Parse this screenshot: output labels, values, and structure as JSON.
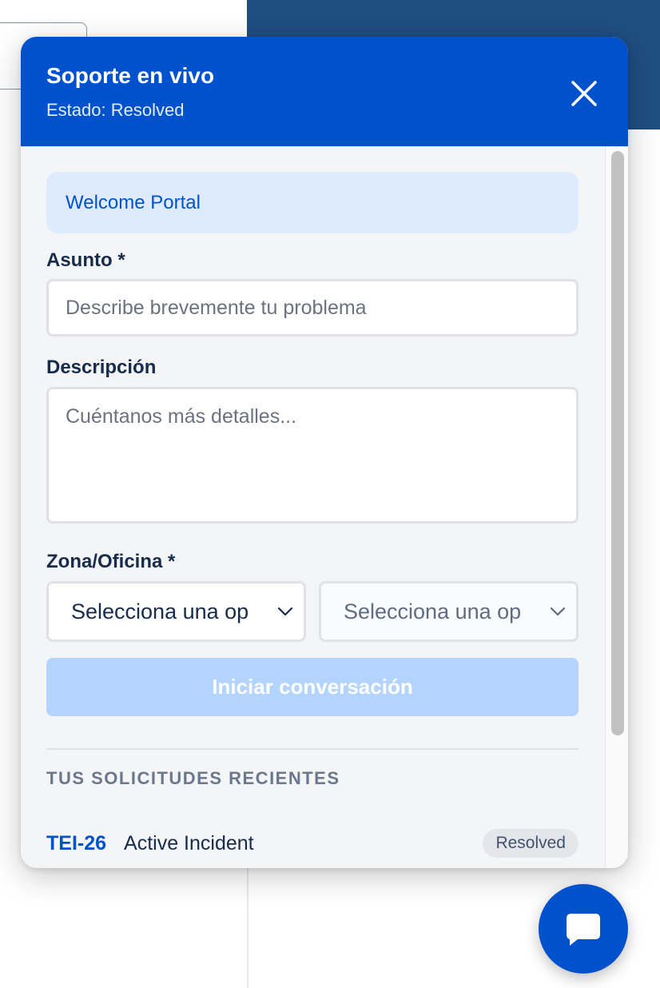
{
  "widget": {
    "title": "Soporte en vivo",
    "status": "Estado: Resolved",
    "close_icon": "close-icon",
    "welcome": "Welcome Portal"
  },
  "form": {
    "subject_label": "Asunto *",
    "subject_placeholder": "Describe brevemente tu problema",
    "description_label": "Descripción",
    "description_placeholder": "Cuéntanos más detalles...",
    "zone_label": "Zona/Oficina *",
    "zone_select_1": "Selecciona una op",
    "zone_select_2": "Selecciona una op",
    "submit_label": "Iniciar conversación"
  },
  "recent": {
    "heading": "TUS SOLICITUDES RECIENTES",
    "items": [
      {
        "key": "TEI-26",
        "title": "Active Incident",
        "status": "Resolved"
      }
    ]
  },
  "colors": {
    "brand": "#0052cc",
    "disabled_button": "#b3d4ff",
    "banner_bg": "#deebff"
  },
  "icons": {
    "chat_button": "chat-bubble-icon",
    "select_chevron": "chevron-down-icon"
  }
}
